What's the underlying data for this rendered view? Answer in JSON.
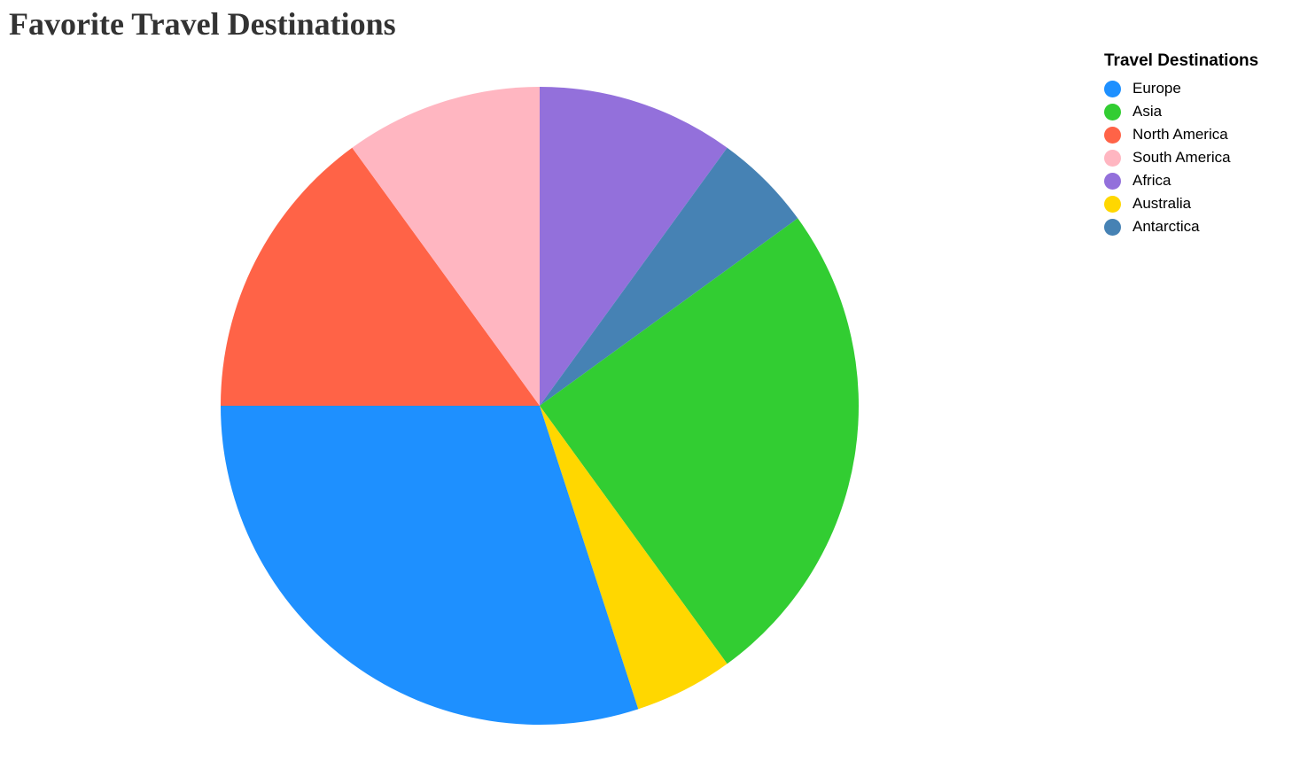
{
  "chart_data": {
    "type": "pie",
    "title": "Favorite Travel Destinations",
    "legend_title": "Travel Destinations",
    "legend_position": "top-right",
    "start_category": "Africa",
    "direction": "clockwise",
    "slices": [
      {
        "label": "Africa",
        "value": 10,
        "color": "#9370DB"
      },
      {
        "label": "Antarctica",
        "value": 5,
        "color": "#4682B4"
      },
      {
        "label": "Asia",
        "value": 25,
        "color": "#32CD32"
      },
      {
        "label": "Australia",
        "value": 5,
        "color": "#FFD700"
      },
      {
        "label": "Europe",
        "value": 30,
        "color": "#1E90FF"
      },
      {
        "label": "North America",
        "value": 15,
        "color": "#FF6347"
      },
      {
        "label": "South America",
        "value": 10,
        "color": "#FFB6C1"
      }
    ],
    "legend_order": [
      "Europe",
      "Asia",
      "North America",
      "South America",
      "Africa",
      "Australia",
      "Antarctica"
    ]
  }
}
